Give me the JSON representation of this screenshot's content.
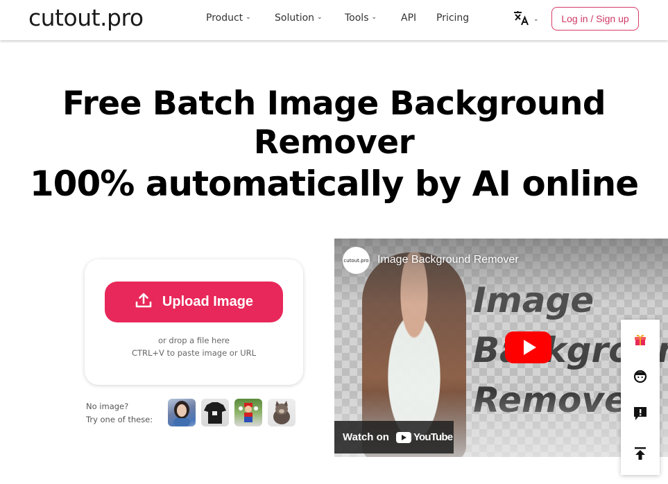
{
  "header": {
    "logo": "cutout.pro",
    "nav": [
      {
        "label": "Product",
        "dropdown": true
      },
      {
        "label": "Solution",
        "dropdown": true
      },
      {
        "label": "Tools",
        "dropdown": true
      },
      {
        "label": "API",
        "dropdown": false
      },
      {
        "label": "Pricing",
        "dropdown": false
      }
    ],
    "language_icon": "translate-icon",
    "login_label": "Log in / Sign up"
  },
  "hero": {
    "line1": "Free Batch Image Background",
    "line2": "Remover",
    "line3": "100% automatically by AI online"
  },
  "upload": {
    "button_label": "Upload Image",
    "button_icon": "upload-icon",
    "drop_text": "or drop a file here",
    "paste_text": "CTRL+V to paste image or URL",
    "accent_color": "#e8285a"
  },
  "samples": {
    "label_line1": "No image?",
    "label_line2": "Try one of these:",
    "items": [
      "child portrait",
      "black t-shirt",
      "mario figure",
      "puppy"
    ]
  },
  "video": {
    "channel": "cutout.pro",
    "title": "Image Background Remover",
    "overlay_words": [
      "Image",
      "Background",
      "Remover"
    ],
    "watch_on": "Watch on",
    "platform": "YouTube"
  },
  "side_panel": {
    "items": [
      "gift-icon",
      "support-agent-icon",
      "feedback-icon",
      "back-to-top-icon"
    ]
  }
}
